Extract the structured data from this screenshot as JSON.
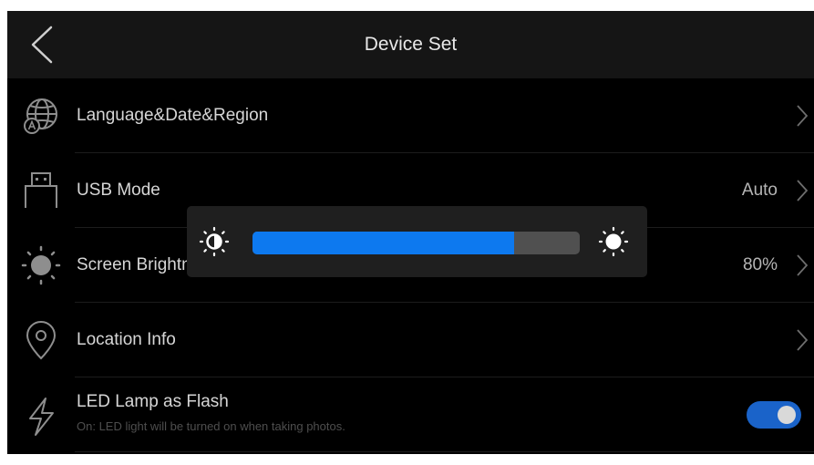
{
  "header": {
    "title": "Device Set",
    "back_icon": "chevron-left-icon"
  },
  "rows": [
    {
      "label": "Language&Date&Region",
      "value": "",
      "icon": "globe-language-icon"
    },
    {
      "label": "USB Mode",
      "value": "Auto",
      "icon": "usb-icon"
    },
    {
      "label": "Screen Brightness",
      "value": "80%",
      "icon": "sun-icon"
    },
    {
      "label": "Location Info",
      "value": "",
      "icon": "location-pin-icon"
    },
    {
      "label": "LED Lamp as Flash",
      "sublabel": "On: LED light will be turned on when taking photos.",
      "icon": "flash-icon",
      "toggle_on": true
    }
  ],
  "brightness_popup": {
    "level_percent": 80,
    "min_icon": "brightness-low-icon",
    "max_icon": "brightness-high-icon",
    "fill_color": "#0d79ef"
  },
  "colors": {
    "background": "#000000",
    "header": "#151515",
    "accent": "#1a63c9"
  }
}
